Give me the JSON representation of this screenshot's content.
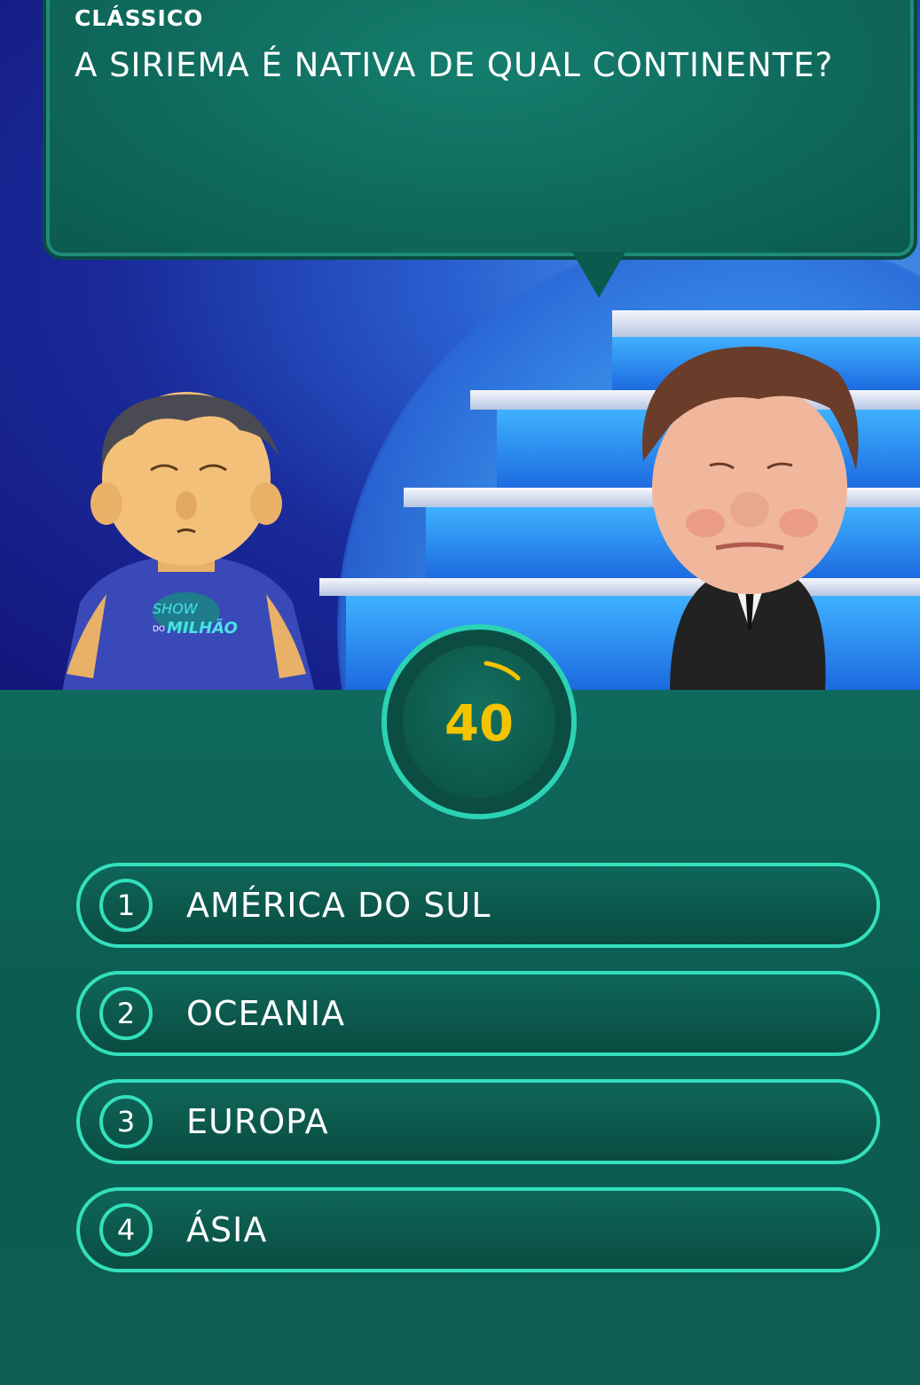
{
  "header": {
    "category": "CLÁSSICO",
    "question": "A SIRIEMA É NATIVA DE QUAL CONTINENTE?"
  },
  "contestant": {
    "shirt_logo_top": "SHOW",
    "shirt_logo_small": "DO",
    "shirt_logo_bottom": "MILHÃO"
  },
  "timer": {
    "value": "40"
  },
  "answers": [
    {
      "number": "1",
      "label": "AMÉRICA DO SUL"
    },
    {
      "number": "2",
      "label": "OCEANIA"
    },
    {
      "number": "3",
      "label": "EUROPA"
    },
    {
      "number": "4",
      "label": "ÁSIA"
    }
  ],
  "colors": {
    "accent": "#33e0bd",
    "timer_text": "#f5c400",
    "panel": "#0f6a5d"
  }
}
